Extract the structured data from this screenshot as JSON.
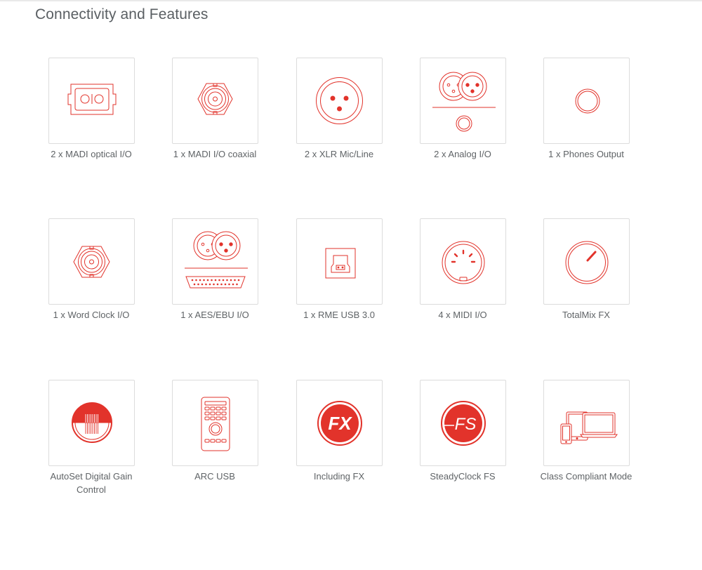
{
  "section": {
    "title": "Connectivity and Features"
  },
  "theme": {
    "accent": "#e2332b",
    "tile_border": "#dcdcdc",
    "text": "#5f6366"
  },
  "features": [
    {
      "label": "2 x MADI optical I/O",
      "icon": "madi-optical-icon"
    },
    {
      "label": "1 x MADI I/O coaxial",
      "icon": "bnc-coaxial-icon"
    },
    {
      "label": "2 x XLR Mic/Line",
      "icon": "xlr-connector-icon"
    },
    {
      "label": "2 x Analog I/O",
      "icon": "analog-io-icon"
    },
    {
      "label": "1 x Phones Output",
      "icon": "phones-jack-icon"
    },
    {
      "label": "1 x Word Clock I/O",
      "icon": "word-clock-bnc-icon"
    },
    {
      "label": "1 x AES/EBU I/O",
      "icon": "aes-ebu-icon"
    },
    {
      "label": "1 x RME USB 3.0",
      "icon": "usb-port-icon"
    },
    {
      "label": "4 x MIDI I/O",
      "icon": "midi-din-icon"
    },
    {
      "label": "TotalMix FX",
      "icon": "totalmix-knob-icon"
    },
    {
      "label": "AutoSet Digital Gain Control",
      "icon": "autoset-gain-icon"
    },
    {
      "label": "ARC USB",
      "icon": "arc-remote-icon"
    },
    {
      "label": "Including FX",
      "icon": "fx-badge-icon",
      "icon_text": "FX"
    },
    {
      "label": "SteadyClock FS",
      "icon": "steadyclock-fs-icon",
      "icon_text": "FS"
    },
    {
      "label": "Class Compliant Mode",
      "icon": "devices-icon"
    }
  ]
}
